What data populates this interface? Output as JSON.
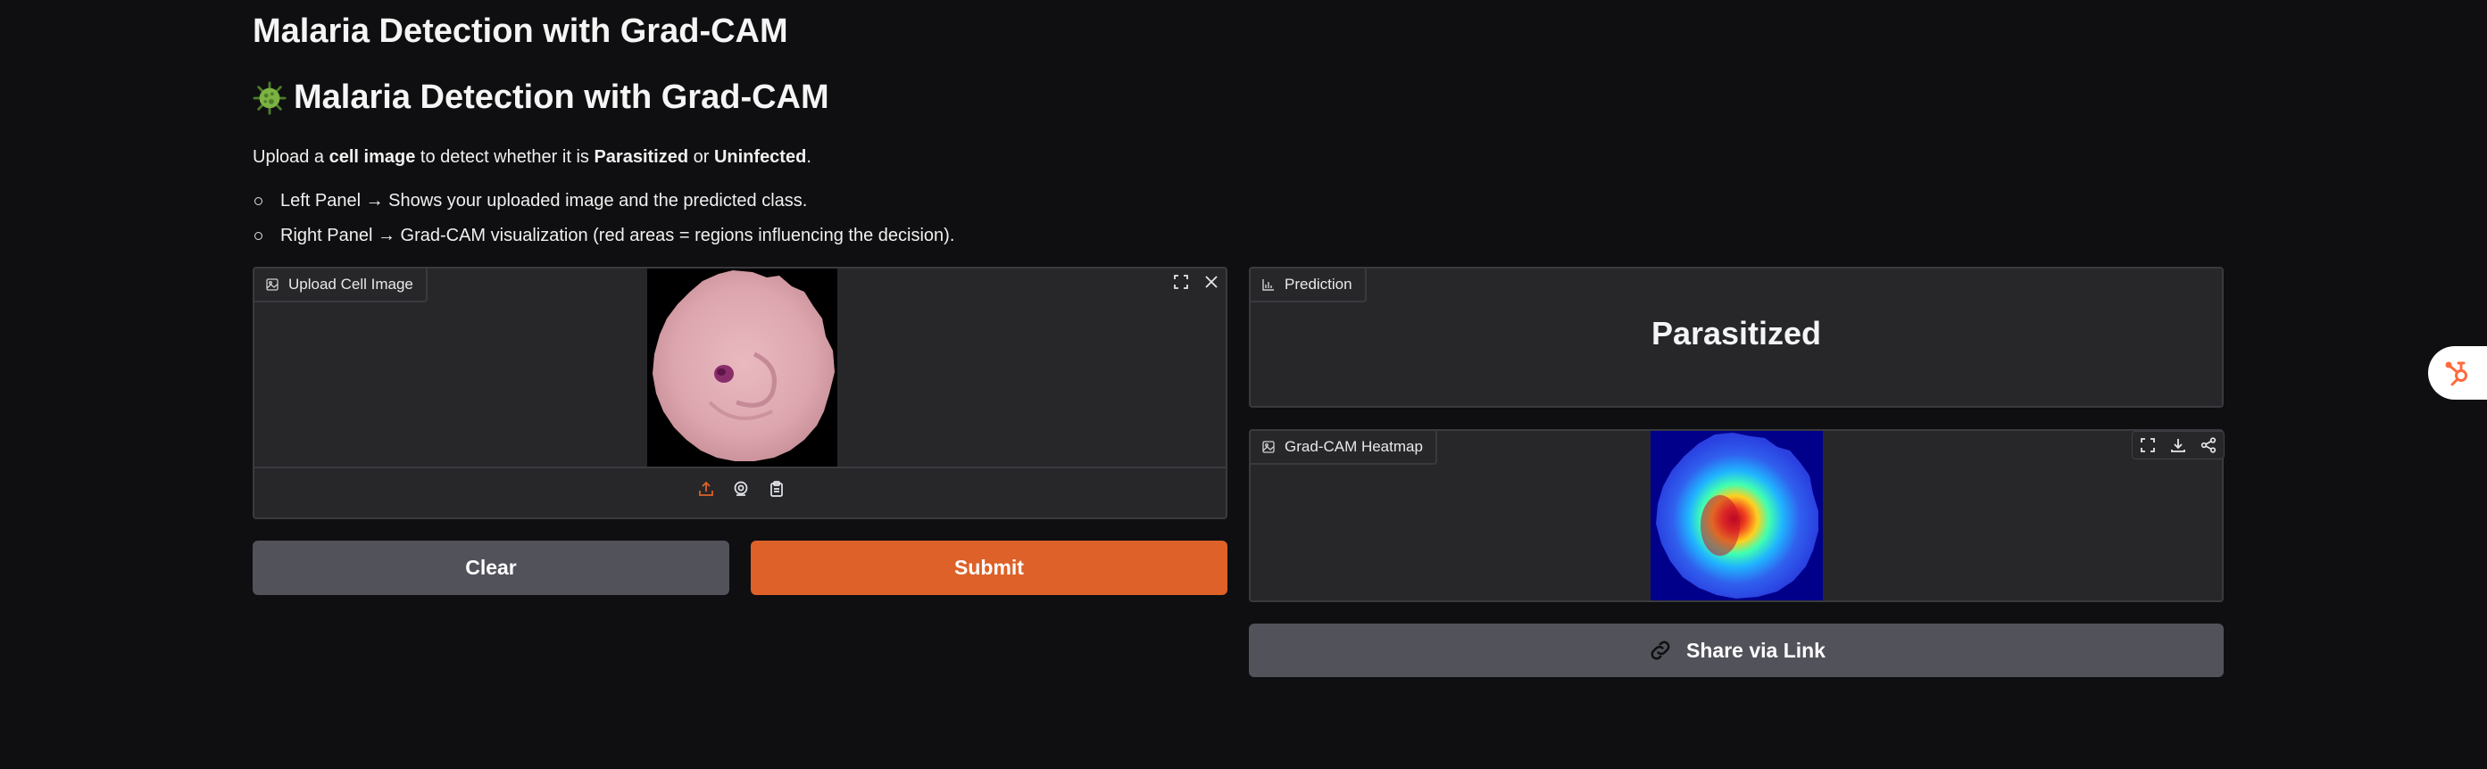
{
  "page": {
    "title": "Malaria Detection with Grad-CAM",
    "heading": "Malaria Detection with Grad-CAM",
    "intro": {
      "prefix": "Upload a ",
      "bold1": "cell image",
      "middle": " to detect whether it is ",
      "bold2": "Parasitized",
      "or": " or ",
      "bold3": "Uninfected",
      "suffix": "."
    },
    "bullets": [
      "Left Panel → Shows your uploaded image and the predicted class.",
      "Right Panel → Grad-CAM visualization (red areas = regions influencing the decision)."
    ]
  },
  "upload_panel": {
    "label": "Upload Cell Image",
    "toolbar_icons": [
      "expand-icon",
      "close-icon"
    ],
    "source_icons": [
      "upload-icon",
      "webcam-icon",
      "clipboard-icon"
    ]
  },
  "buttons": {
    "clear": "Clear",
    "submit": "Submit",
    "share": "Share via Link"
  },
  "prediction_panel": {
    "label": "Prediction",
    "value": "Parasitized"
  },
  "gradcam_panel": {
    "label": "Grad-CAM Heatmap",
    "toolbar_icons": [
      "expand-icon",
      "download-icon",
      "share-icon"
    ]
  },
  "colors": {
    "background": "#0f0f11",
    "panel": "#27272a",
    "accent": "#dd6128",
    "secondary_button": "#52525b"
  }
}
